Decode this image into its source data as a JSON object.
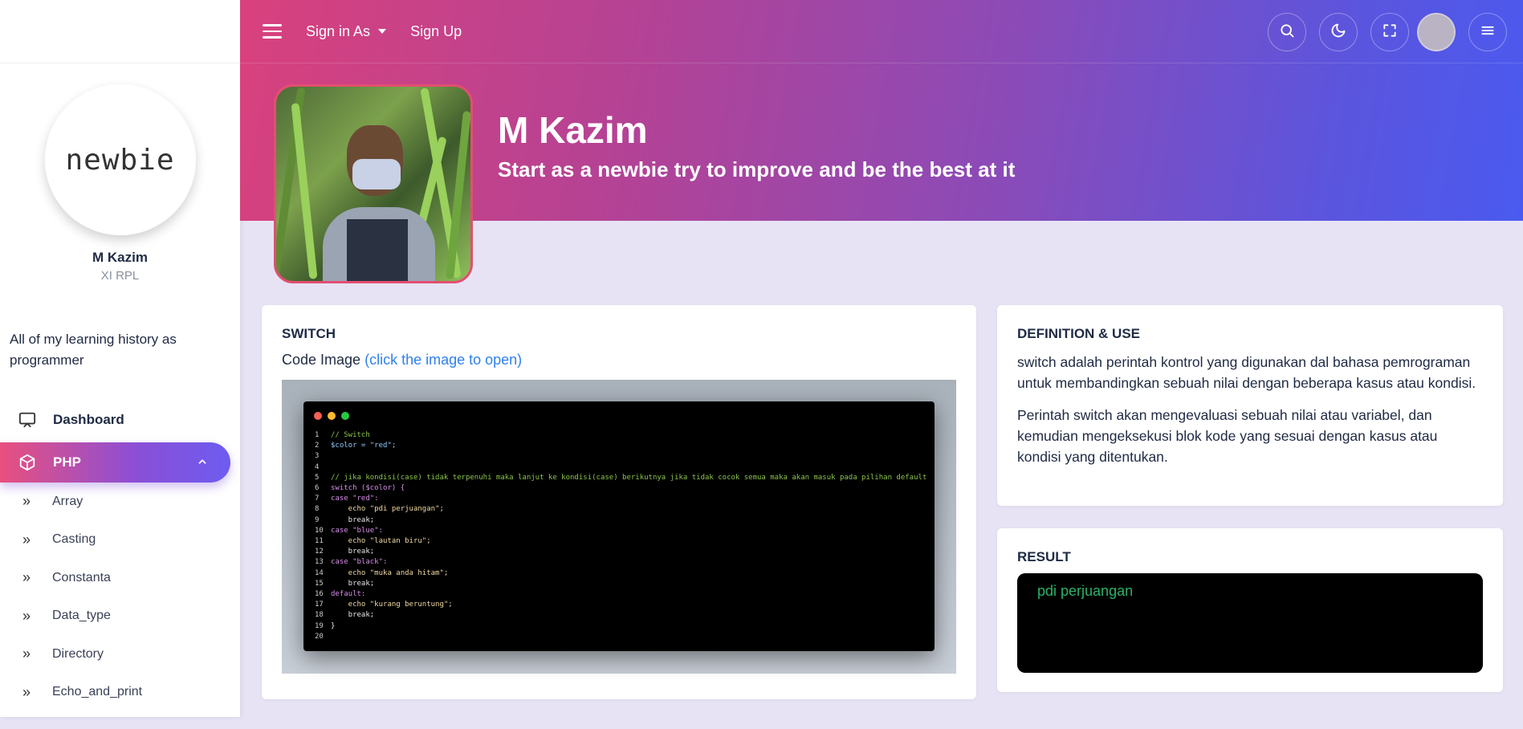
{
  "topbar": {
    "sign_in_label": "Sign in As",
    "sign_up_label": "Sign Up"
  },
  "sidebar": {
    "logo_text": "newbie",
    "profile_name": "M Kazim",
    "profile_class": "XI RPL",
    "description": "All of my learning history as programmer",
    "nav": {
      "dashboard": "Dashboard",
      "php": "PHP"
    },
    "sub_items": [
      "Array",
      "Casting",
      "Constanta",
      "Data_type",
      "Directory",
      "Echo_and_print"
    ]
  },
  "hero": {
    "name": "M Kazim",
    "tagline": "Start as a newbie try to improve and be the best at it"
  },
  "switch_card": {
    "title": "SWITCH",
    "code_image_label": "Code Image",
    "code_image_link": "(click the image to open)",
    "code_lines": [
      {
        "n": "1",
        "text": "// Switch"
      },
      {
        "n": "2",
        "text": "$color = \"red\";"
      },
      {
        "n": "3",
        "text": ""
      },
      {
        "n": "4",
        "text": ""
      },
      {
        "n": "5",
        "text": "// jika kondisi(case) tidak terpenuhi maka lanjut ke kondisi(case) berikutnya jika tidak cocok semua maka akan masuk pada pilihan default"
      },
      {
        "n": "6",
        "text": "switch ($color) {"
      },
      {
        "n": "7",
        "text": "case \"red\":"
      },
      {
        "n": "8",
        "text": "    echo \"pdi perjuangan\";"
      },
      {
        "n": "9",
        "text": "    break;"
      },
      {
        "n": "10",
        "text": "case \"blue\":"
      },
      {
        "n": "11",
        "text": "    echo \"lautan biru\";"
      },
      {
        "n": "12",
        "text": "    break;"
      },
      {
        "n": "13",
        "text": "case \"black\":"
      },
      {
        "n": "14",
        "text": "    echo \"muka anda hitam\";"
      },
      {
        "n": "15",
        "text": "    break;"
      },
      {
        "n": "16",
        "text": "default:"
      },
      {
        "n": "17",
        "text": "    echo \"kurang beruntung\";"
      },
      {
        "n": "18",
        "text": "    break;"
      },
      {
        "n": "19",
        "text": "}"
      },
      {
        "n": "20",
        "text": ""
      }
    ]
  },
  "definition_card": {
    "title": "DEFINITION & USE",
    "paragraph_1": "switch adalah perintah kontrol yang digunakan dal bahasa pemrograman untuk membandingkan sebuah nilai dengan beberapa kasus atau kondisi.",
    "paragraph_2": "Perintah switch akan mengevaluasi sebuah nilai atau variabel, dan kemudian mengeksekusi blok kode yang sesuai dengan kasus atau kondisi yang ditentukan."
  },
  "result_card": {
    "title": "RESULT",
    "output": "pdi perjuangan"
  },
  "colors": {
    "accent_link": "#2f80ed",
    "result_text": "#29b36a",
    "gradient_start": "#d9417d",
    "gradient_end": "#4a5af0"
  }
}
